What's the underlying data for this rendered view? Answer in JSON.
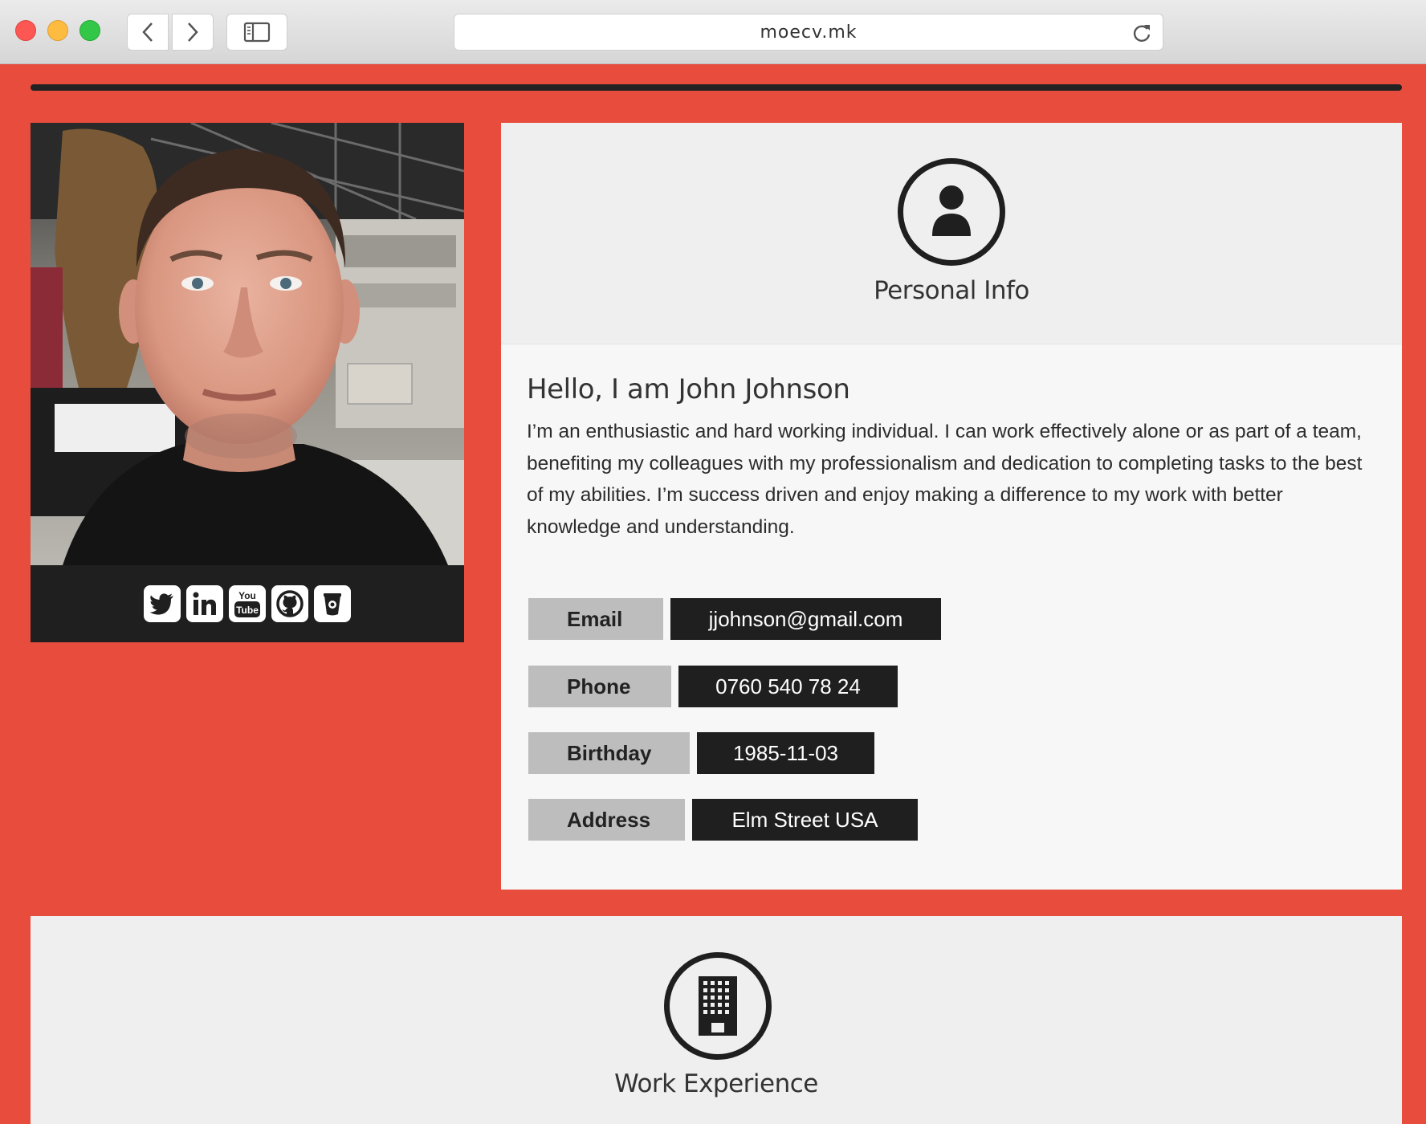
{
  "browser": {
    "url": "moecv.mk"
  },
  "profile": {
    "photo_alt": "Profile photo of John Johnson",
    "social_links": [
      {
        "name": "twitter-icon"
      },
      {
        "name": "linkedin-icon"
      },
      {
        "name": "youtube-icon",
        "label": "You Tube"
      },
      {
        "name": "github-icon"
      },
      {
        "name": "stack-icon"
      }
    ]
  },
  "personal_info": {
    "section_title": "Personal Info",
    "greeting": "Hello, I am John Johnson",
    "bio": "I’m an enthusiastic and hard working individual. I can work effectively alone or as part of a team, benefiting my colleagues with my professionalism and dedication to completing tasks to the best of my abilities. I’m success driven and enjoy making a difference to my work with better knowledge and understanding.",
    "fields": {
      "email": {
        "label": "Email",
        "value": "jjohnson@gmail.com"
      },
      "phone": {
        "label": "Phone",
        "value": "0760 540 78 24"
      },
      "birthday": {
        "label": "Birthday",
        "value": "1985-11-03"
      },
      "address": {
        "label": "Address",
        "value": "Elm Street USA"
      }
    }
  },
  "work_experience": {
    "section_title": "Work Experience"
  },
  "colors": {
    "accent": "#e74c3c",
    "dark": "#1f1f1f",
    "label_gray": "#bdbdbd"
  }
}
